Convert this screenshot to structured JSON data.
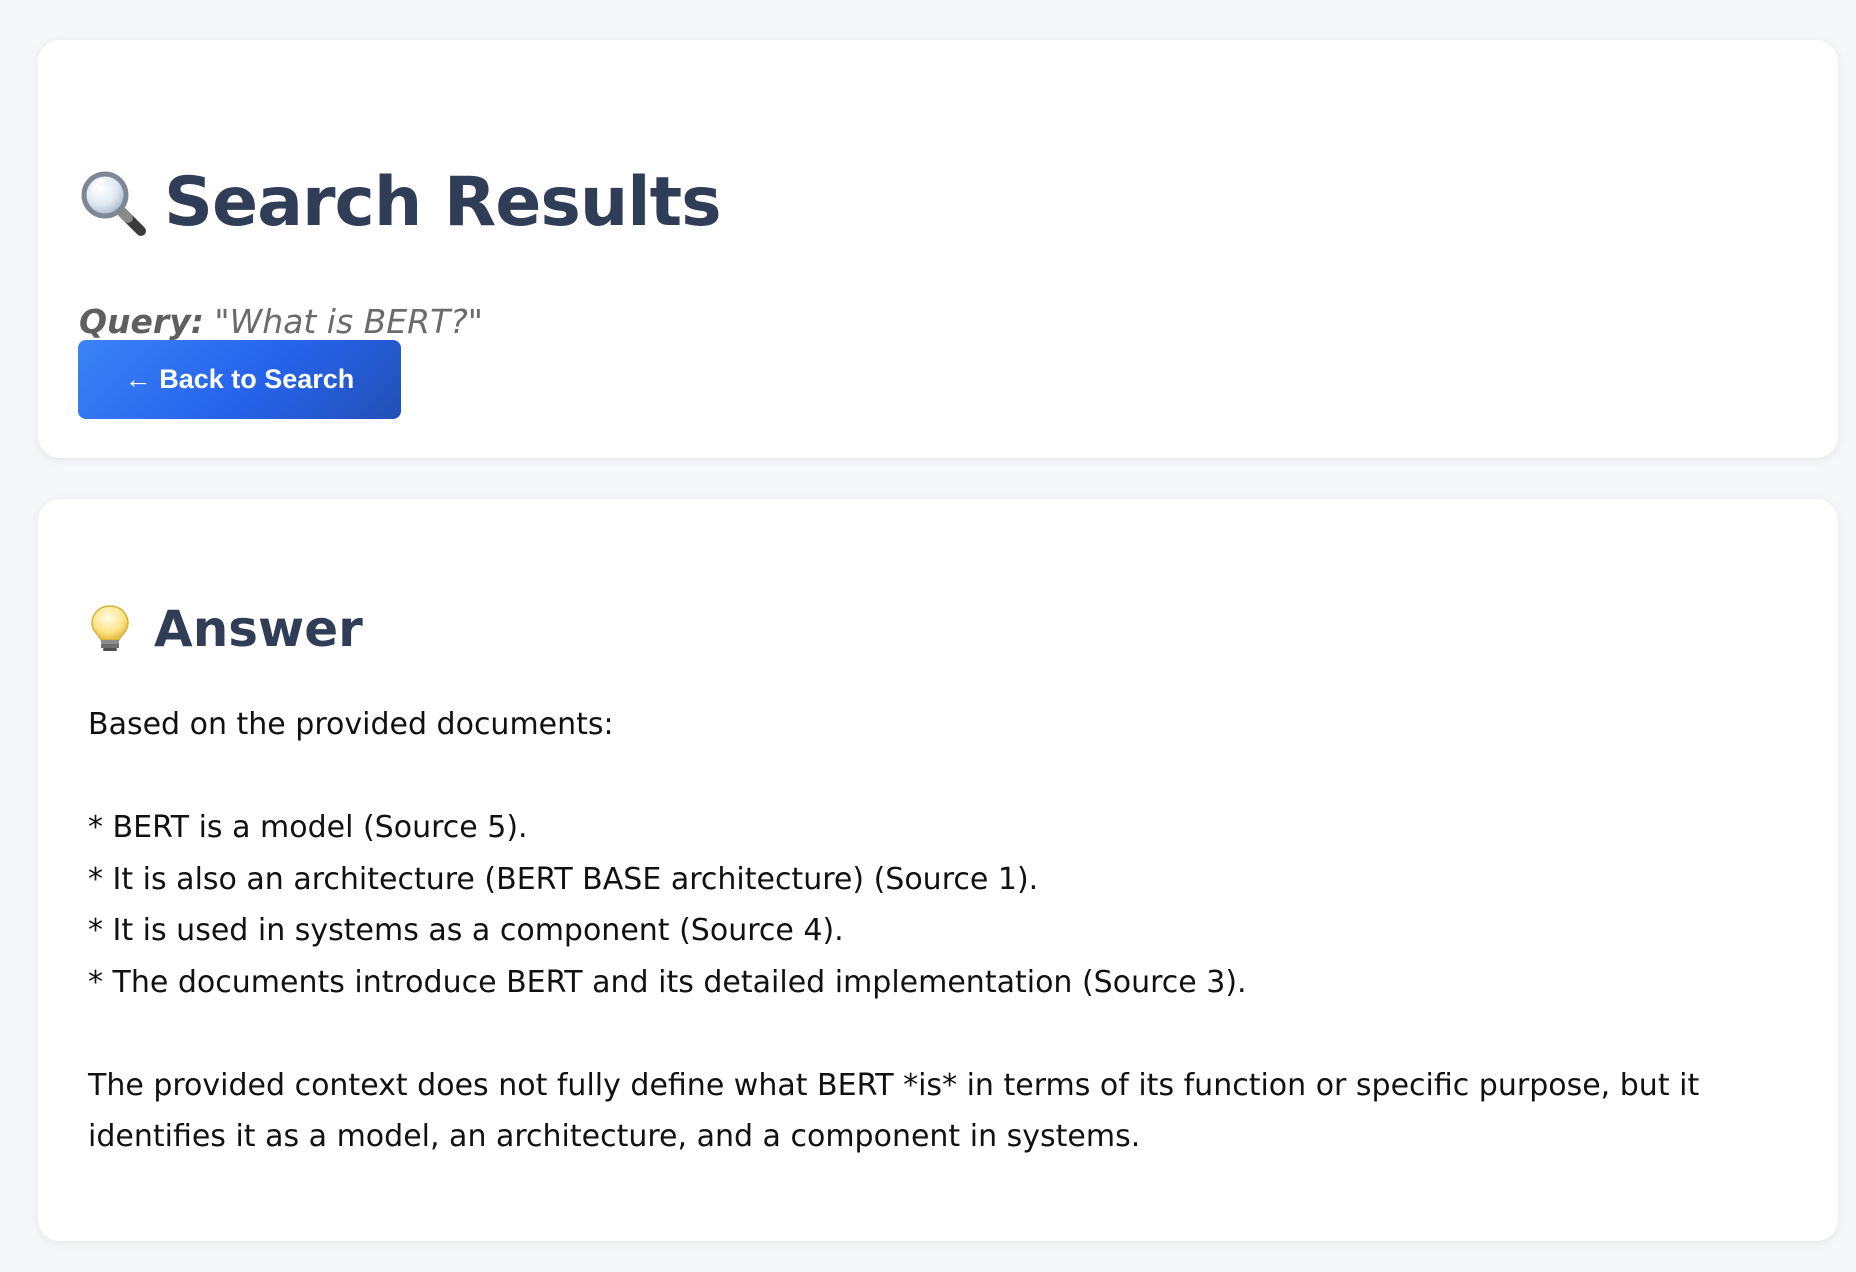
{
  "header": {
    "title": "Search Results",
    "title_icon": "magnifier-icon",
    "query_label": "Query:",
    "query_text": "\"What is BERT?\"",
    "back_button_label": "← Back to Search"
  },
  "answer": {
    "title": "Answer",
    "title_icon": "lightbulb-icon",
    "intro": "Based on the provided documents:",
    "bullets": [
      "* BERT is a model (Source 5).",
      "* It is also an architecture (BERT BASE architecture) (Source 1).",
      "* It is used in systems as a component (Source 4).",
      "* The documents introduce BERT and its detailed implementation (Source 3)."
    ],
    "conclusion": "The provided context does not fully define what BERT *is* in terms of its function or specific purpose, but it identifies it as a model, an architecture, and a component in systems."
  },
  "colors": {
    "background": "#f6f7f9",
    "card": "#ffffff",
    "heading": "#2f3e56",
    "button_start": "#3b82f6",
    "button_end": "#2450b5"
  }
}
